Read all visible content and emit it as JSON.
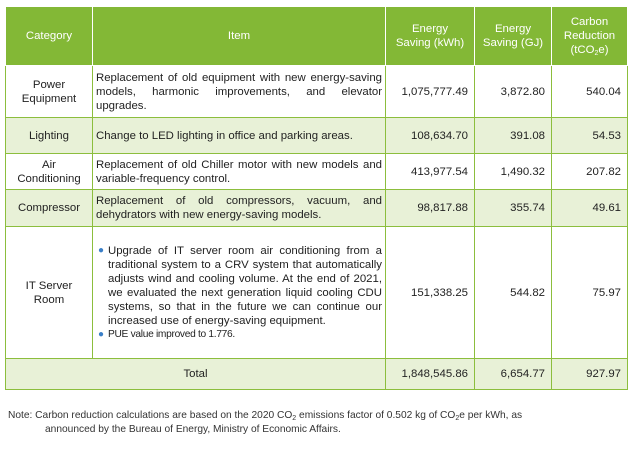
{
  "headers": {
    "category": "Category",
    "item": "Item",
    "kwh_line1": "Energy",
    "kwh_line2": "Saving (kWh)",
    "gj_line1": "Energy",
    "gj_line2": "Saving (GJ)",
    "carbon_line1": "Carbon",
    "carbon_line2": "Reduction",
    "carbon_line3_pre": "(tCO",
    "carbon_line3_sub": "2",
    "carbon_line3_post": "e)"
  },
  "rows": [
    {
      "category_line1": "Power",
      "category_line2": "Equipment",
      "item": "Replacement of old equipment with new energy-saving models, harmonic improvements, and elevator upgrades.",
      "kwh": "1,075,777.49",
      "gj": "3,872.80",
      "carbon": "540.04"
    },
    {
      "category_line1": "Lighting",
      "category_line2": "",
      "item": "Change to LED lighting in office  and parking areas.",
      "kwh": "108,634.70",
      "gj": "391.08",
      "carbon": "54.53"
    },
    {
      "category_line1": "Air",
      "category_line2": "Conditioning",
      "item": "Replacement of old Chiller motor with new models and variable-frequency control.",
      "kwh": "413,977.54",
      "gj": "1,490.32",
      "carbon": "207.82"
    },
    {
      "category_line1": "Compressor",
      "category_line2": "",
      "item": "Replacement of old compressors, vacuum, and dehydrators with new energy-saving models.",
      "kwh": "98,817.88",
      "gj": "355.74",
      "carbon": "49.61"
    },
    {
      "category_line1": "IT Server",
      "category_line2": "Room",
      "bullets": [
        "Upgrade of IT server room air conditioning from a traditional system to a CRV system that automatically adjusts wind and cooling volume. At the end of 2021, we evaluated the next generation liquid cooling CDU systems, so that in the future we can continue our increased use of energy-saving equipment.",
        "PUE value improved to 1.776."
      ],
      "kwh": "151,338.25",
      "gj": "544.82",
      "carbon": "75.97"
    }
  ],
  "total": {
    "label": "Total",
    "kwh": "1,848,545.86",
    "gj": "6,654.77",
    "carbon": "927.97"
  },
  "note": {
    "part1": "Note: Carbon reduction calculations are based on the 2020 CO",
    "sub1": "2",
    "part2": " emissions factor of 0.502 kg of CO",
    "sub2": "2",
    "part3": "e per kWh, as",
    "line2": "announced by the Bureau of Energy, Ministry of Economic Affairs."
  },
  "colors": {
    "header_green": "#83b836",
    "row_tint": "#e8f1d7",
    "border_green": "#8cbe3d",
    "bullet_blue": "#3a7fc8"
  }
}
